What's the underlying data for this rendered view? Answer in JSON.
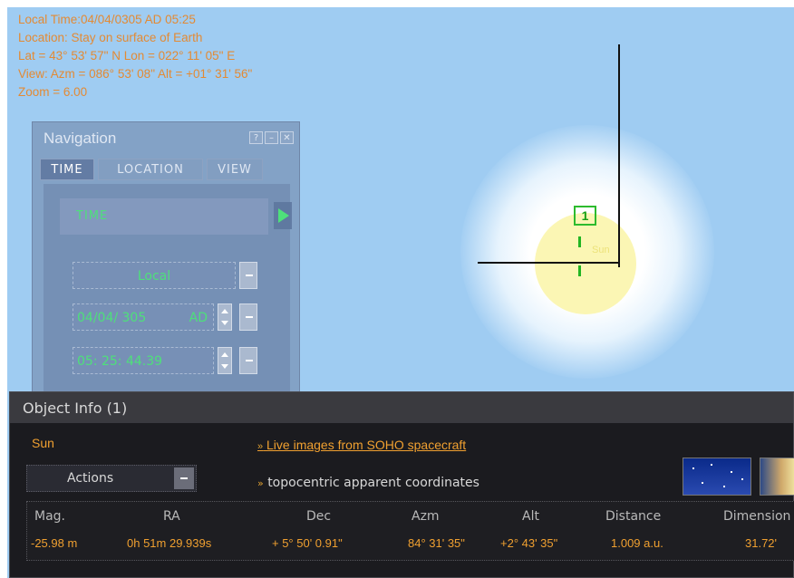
{
  "overlay": {
    "lines": [
      "Local Time:04/04/0305 AD 05:25",
      "Location: Stay on surface of Earth",
      "Lat = 43° 53' 57\" N  Lon = 022° 11' 05\" E",
      "View: Azm = 086° 53' 08\"  Alt = +01° 31' 56\"",
      "Zoom = 6.00"
    ],
    "text_color": "#e38a34"
  },
  "sky": {
    "marker_number": "1",
    "object_label": "Sun",
    "sky_color": "#9fccf2",
    "marker_color": "#2dbb2d"
  },
  "navigation": {
    "title": "Navigation",
    "window_buttons": [
      "?",
      "–",
      "✕"
    ],
    "tabs": [
      {
        "label": "TIME",
        "active": true
      },
      {
        "label": "LOCATION",
        "active": false
      },
      {
        "label": "VIEW",
        "active": false
      }
    ],
    "section_label": "TIME",
    "time_zone": "Local",
    "date": "04/04/ 305",
    "era": "AD",
    "time": "05: 25: 44.39",
    "value_color": "#4ee07a"
  },
  "object_info": {
    "title": "Object Info (1)",
    "object_name": "Sun",
    "link_text": "Live images from SOHO spacecraft",
    "coords_text": "topocentric apparent coordinates",
    "actions_label": "Actions",
    "bullet": "»",
    "columns": [
      "Mag.",
      "RA",
      "Dec",
      "Azm",
      "Alt",
      "Distance",
      "Dimension"
    ],
    "values": [
      "-25.98 m",
      "0h 51m 29.939s",
      "+ 5° 50' 0.91\"",
      "84° 31' 35\"",
      "+2° 43' 35\"",
      "1.009 a.u.",
      "31.72'"
    ],
    "accent_color": "#f0a030"
  }
}
